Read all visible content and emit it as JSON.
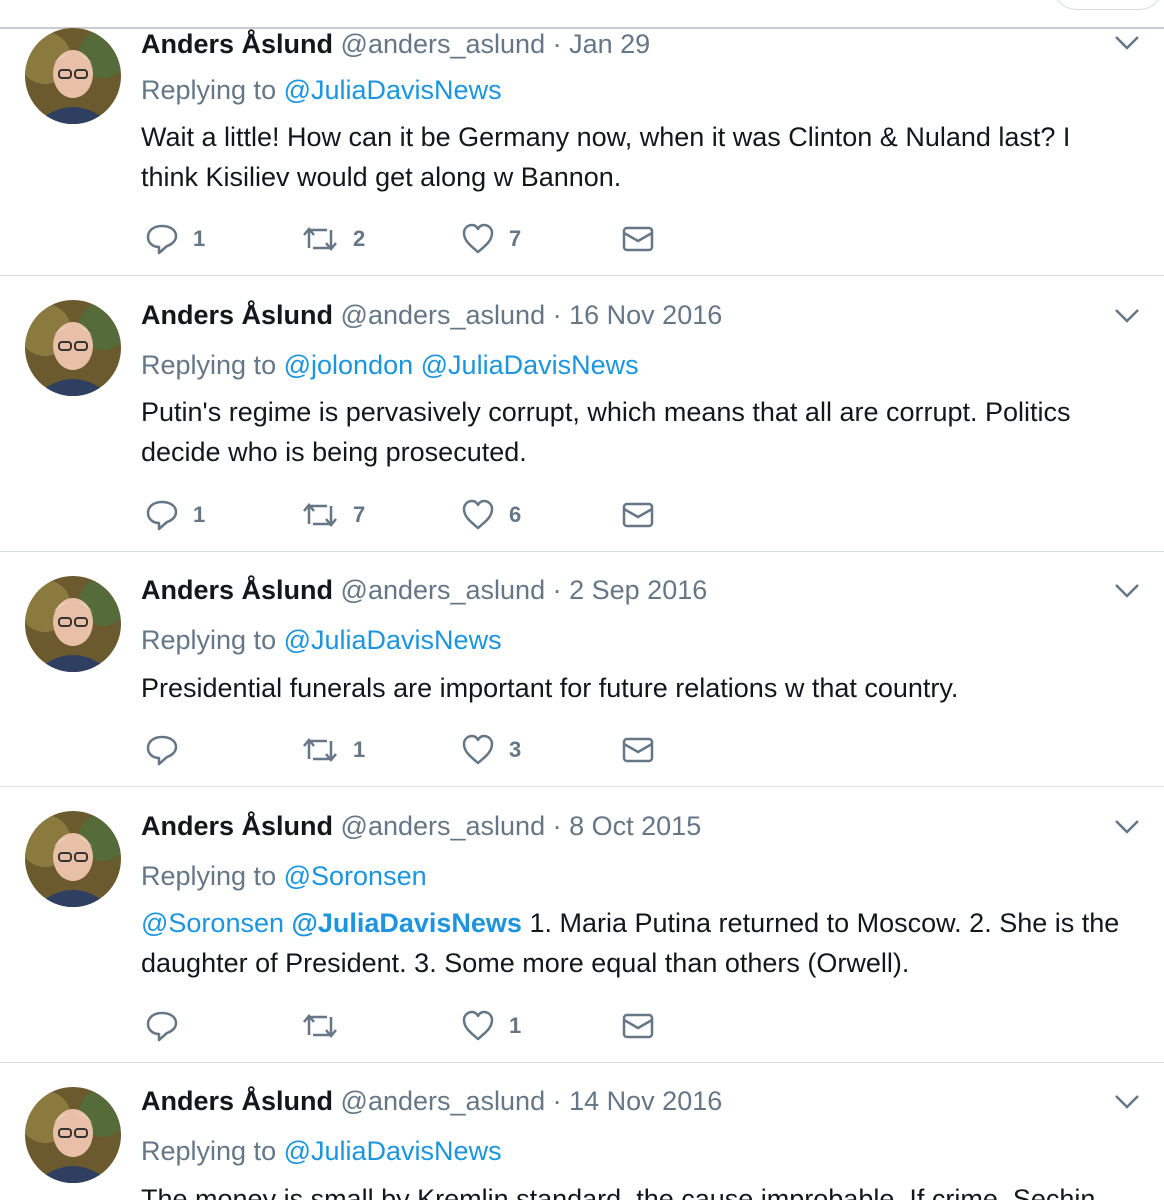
{
  "colors": {
    "link": "#1b95e0",
    "muted": "#657786",
    "text": "#14171a",
    "divider": "#d7dde2"
  },
  "icons": {
    "reply": "reply-icon",
    "retweet": "retweet-icon",
    "like": "heart-icon",
    "dm": "envelope-icon",
    "more": "chevron-down-icon"
  },
  "tweets": [
    {
      "name": "Anders Åslund",
      "handle": "@anders_aslund",
      "separator": "·",
      "date": "Jan 29",
      "reply_prefix": "Replying to",
      "reply_to": [
        "@JuliaDavisNews"
      ],
      "text_mentions": [],
      "text": "Wait a little! How can it be Germany now, when it was Clinton & Nuland last? I think Kisiliev would get along w Bannon.",
      "replies": "1",
      "retweets": "2",
      "likes": "7"
    },
    {
      "name": "Anders Åslund",
      "handle": "@anders_aslund",
      "separator": "·",
      "date": "16 Nov 2016",
      "reply_prefix": "Replying to",
      "reply_to": [
        "@jolondon",
        "@JuliaDavisNews"
      ],
      "text_mentions": [],
      "text": "Putin's regime is pervasively corrupt, which means that all are corrupt. Politics decide who is being prosecuted.",
      "replies": "1",
      "retweets": "7",
      "likes": "6"
    },
    {
      "name": "Anders Åslund",
      "handle": "@anders_aslund",
      "separator": "·",
      "date": "2 Sep 2016",
      "reply_prefix": "Replying to",
      "reply_to": [
        "@JuliaDavisNews"
      ],
      "text_mentions": [],
      "text": "Presidential funerals are important for future relations w that country.",
      "replies": "",
      "retweets": "1",
      "likes": "3"
    },
    {
      "name": "Anders Åslund",
      "handle": "@anders_aslund",
      "separator": "·",
      "date": "8 Oct 2015",
      "reply_prefix": "Replying to",
      "reply_to": [
        "@Soronsen"
      ],
      "text_mentions": [
        "@Soronsen",
        "@JuliaDavisNews"
      ],
      "text": "1. Maria Putina returned to Moscow. 2. She is the daughter of President. 3. Some more equal than others (Orwell).",
      "replies": "",
      "retweets": "",
      "likes": "1"
    },
    {
      "name": "Anders Åslund",
      "handle": "@anders_aslund",
      "separator": "·",
      "date": "14 Nov 2016",
      "reply_prefix": "Replying to",
      "reply_to": [
        "@JuliaDavisNews"
      ],
      "text_mentions": [],
      "text": "The money is small by Kremlin standard, the cause improbable. If crime, Sechin",
      "replies": "",
      "retweets": "",
      "likes": ""
    }
  ]
}
